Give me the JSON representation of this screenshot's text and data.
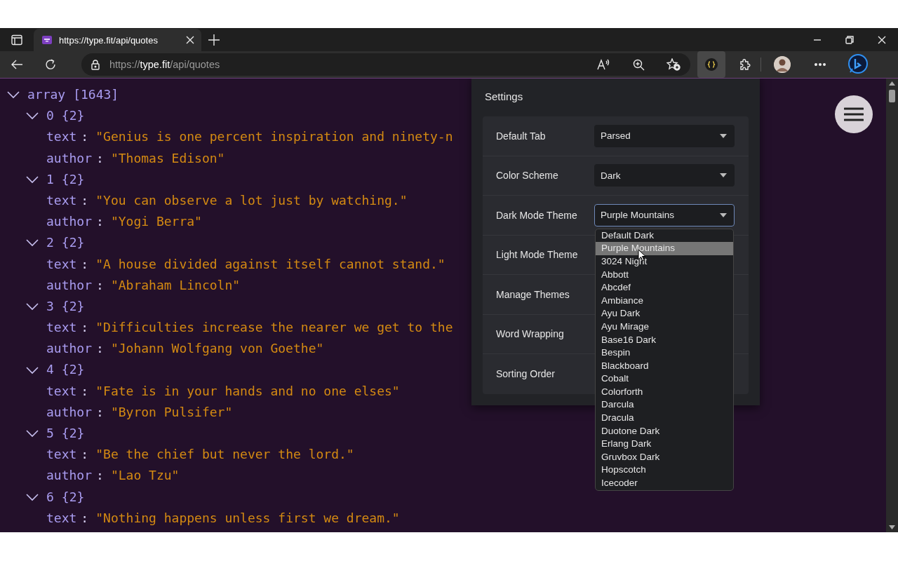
{
  "browser": {
    "tab": {
      "title": "https://type.fit/api/quotes"
    },
    "address": {
      "scheme": "https://",
      "host": "type.fit",
      "path": "/api/quotes"
    }
  },
  "tree": {
    "label": "array",
    "count": "[1643]",
    "expanded": true,
    "children": [
      {
        "label": "0",
        "count": "{2}",
        "expanded": true,
        "children": [
          {
            "key": "text",
            "sep": ":",
            "value": "\"Genius is one percent inspiration and ninety-n"
          },
          {
            "key": "author",
            "sep": ":",
            "value": "\"Thomas Edison\""
          }
        ]
      },
      {
        "label": "1",
        "count": "{2}",
        "expanded": true,
        "children": [
          {
            "key": "text",
            "sep": ":",
            "value": "\"You can observe a lot just by watching.\""
          },
          {
            "key": "author",
            "sep": ":",
            "value": "\"Yogi Berra\""
          }
        ]
      },
      {
        "label": "2",
        "count": "{2}",
        "expanded": true,
        "children": [
          {
            "key": "text",
            "sep": ":",
            "value": "\"A house divided against itself cannot stand.\""
          },
          {
            "key": "author",
            "sep": ":",
            "value": "\"Abraham Lincoln\""
          }
        ]
      },
      {
        "label": "3",
        "count": "{2}",
        "expanded": true,
        "children": [
          {
            "key": "text",
            "sep": ":",
            "value": "\"Difficulties increase the nearer we get to the"
          },
          {
            "key": "author",
            "sep": ":",
            "value": "\"Johann Wolfgang von Goethe\""
          }
        ]
      },
      {
        "label": "4",
        "count": "{2}",
        "expanded": true,
        "children": [
          {
            "key": "text",
            "sep": ":",
            "value": "\"Fate is in your hands and no one elses\""
          },
          {
            "key": "author",
            "sep": ":",
            "value": "\"Byron Pulsifer\""
          }
        ]
      },
      {
        "label": "5",
        "count": "{2}",
        "expanded": true,
        "children": [
          {
            "key": "text",
            "sep": ":",
            "value": "\"Be the chief but never the lord.\""
          },
          {
            "key": "author",
            "sep": ":",
            "value": "\"Lao Tzu\""
          }
        ]
      },
      {
        "label": "6",
        "count": "{2}",
        "expanded": true,
        "children": [
          {
            "key": "text",
            "sep": ":",
            "value": "\"Nothing happens unless first we dream.\""
          }
        ]
      }
    ]
  },
  "settings": {
    "title": "Settings",
    "rows": [
      {
        "label": "Default Tab",
        "kind": "select",
        "value": "Parsed",
        "open": false
      },
      {
        "label": "Color Scheme",
        "kind": "select",
        "value": "Dark",
        "open": false
      },
      {
        "label": "Dark Mode Theme",
        "kind": "select",
        "value": "Purple Mountains",
        "open": true,
        "options": [
          {
            "label": "Default Dark",
            "selected": false
          },
          {
            "label": "Purple Mountains",
            "selected": true
          },
          {
            "label": "3024 Night",
            "selected": false
          },
          {
            "label": "Abbott",
            "selected": false
          },
          {
            "label": "Abcdef",
            "selected": false
          },
          {
            "label": "Ambiance",
            "selected": false
          },
          {
            "label": "Ayu Dark",
            "selected": false
          },
          {
            "label": "Ayu Mirage",
            "selected": false
          },
          {
            "label": "Base16 Dark",
            "selected": false
          },
          {
            "label": "Bespin",
            "selected": false
          },
          {
            "label": "Blackboard",
            "selected": false
          },
          {
            "label": "Cobalt",
            "selected": false
          },
          {
            "label": "Colorforth",
            "selected": false
          },
          {
            "label": "Darcula",
            "selected": false
          },
          {
            "label": "Dracula",
            "selected": false
          },
          {
            "label": "Duotone Dark",
            "selected": false
          },
          {
            "label": "Erlang Dark",
            "selected": false
          },
          {
            "label": "Gruvbox Dark",
            "selected": false
          },
          {
            "label": "Hopscotch",
            "selected": false
          },
          {
            "label": "Icecoder",
            "selected": false
          }
        ]
      },
      {
        "label": "Light Mode Theme",
        "kind": "hidden"
      },
      {
        "label": "Manage Themes",
        "kind": "hidden"
      },
      {
        "label": "Word Wrapping",
        "kind": "hidden"
      },
      {
        "label": "Sorting Order",
        "kind": "hidden"
      }
    ]
  }
}
